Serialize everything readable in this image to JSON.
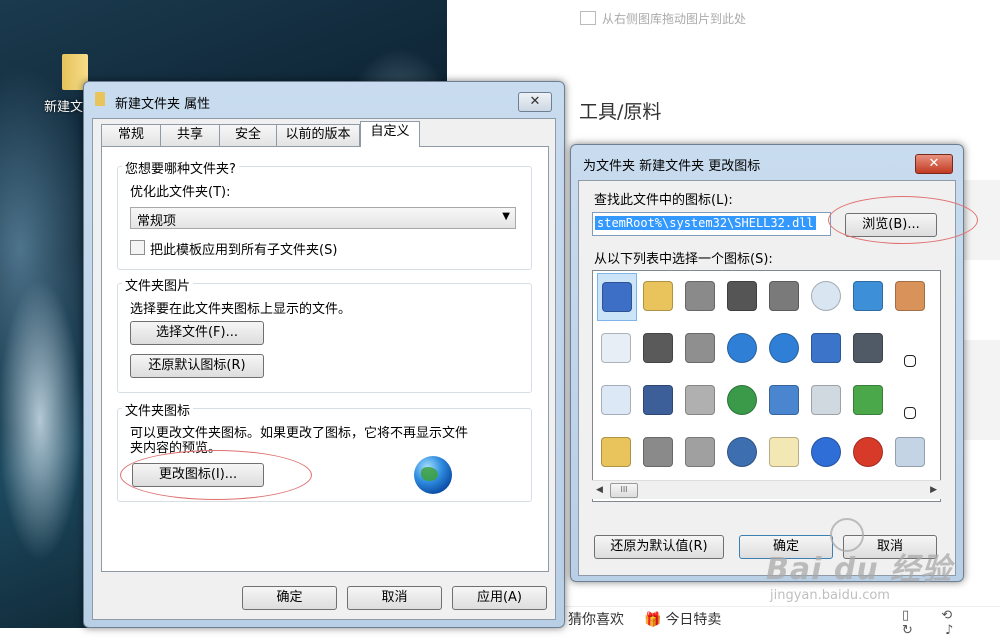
{
  "desktop": {
    "folder_label": "新建文"
  },
  "webpage": {
    "drop_hint": "从右侧图库拖动图片到此处",
    "tools_title": "工具/原料",
    "bottom_guess": "猜你喜欢",
    "bottom_today": "今日特卖",
    "bottom_icons": "▯ ⟲ ↻ ♪"
  },
  "props_dialog": {
    "title": "新建文件夹 属性",
    "close": "✕",
    "tabs": [
      "常规",
      "共享",
      "安全",
      "以前的版本",
      "自定义"
    ],
    "active_tab": "自定义",
    "group1": {
      "title": "您想要哪种文件夹?",
      "optimize_label": "优化此文件夹(T):",
      "optimize_value": "常规项",
      "apply_sub": "把此模板应用到所有子文件夹(S)"
    },
    "group2": {
      "title": "文件夹图片",
      "desc": "选择要在此文件夹图标上显示的文件。",
      "choose_btn": "选择文件(F)...",
      "restore_btn": "还原默认图标(R)"
    },
    "group3": {
      "title": "文件夹图标",
      "desc_line1": "可以更改文件夹图标。如果更改了图标，它将不再显示文件",
      "desc_line2": "夹内容的预览。",
      "change_btn": "更改图标(I)..."
    },
    "ok": "确定",
    "cancel": "取消",
    "apply": "应用(A)"
  },
  "icon_dialog": {
    "title": "为文件夹 新建文件夹 更改图标",
    "close": "✕",
    "find_label": "查找此文件中的图标(L):",
    "path_value": "stemRoot%\\system32\\SHELL32.dll",
    "browse_btn": "浏览(B)...",
    "select_label": "从以下列表中选择一个图标(S):",
    "scroll_thumb": "III",
    "restore_btn": "还原为默认值(R)",
    "ok": "确定",
    "cancel": "取消",
    "icons": [
      "calendar-doc-icon",
      "folder-icon",
      "drive-icon",
      "chip-icon",
      "printer-icon",
      "clock-icon",
      "window-icon",
      "hand-icon",
      "document-icon",
      "printer-network-icon",
      "server-icon",
      "globe-icon",
      "network-globe-icon",
      "control-panel-icon",
      "projector-icon",
      "shortcut-arrow-icon",
      "blank-window-icon",
      "floppy-icon",
      "drive-delete-icon",
      "globe-mouse-icon",
      "network-icon",
      "search-icon",
      "green-arrow-icon",
      "power-small-icon",
      "folder-icon-2",
      "hard-drive-icon",
      "cd-drive-icon",
      "monitor-globe-icon",
      "document-grid-icon",
      "help-icon",
      "power-icon",
      "recycle-bin-icon"
    ],
    "icon_colors": [
      "#3e6fc7",
      "#e9c45c",
      "#8a8a8a",
      "#555555",
      "#7a7a7a",
      "#d9e6f2",
      "#3d8fd8",
      "#d9935a",
      "#e8eef5",
      "#5a5a5a",
      "#8f8f8f",
      "#2f7fd6",
      "#2f7fd6",
      "#3b74c8",
      "#505a66",
      "#ffffff",
      "#dce8f6",
      "#3c5f9a",
      "#b0b0b0",
      "#3a9a4a",
      "#4a86d0",
      "#d0d8e0",
      "#4aa84a",
      "#ffffff",
      "#e9c45c",
      "#8a8a8a",
      "#a0a0a0",
      "#3d6fb0",
      "#f3e7b3",
      "#2f6ed6",
      "#d83a2a",
      "#c4d4e4"
    ]
  },
  "watermark": {
    "big": "Bai du 经验",
    "small": "jingyan.baidu.com"
  }
}
